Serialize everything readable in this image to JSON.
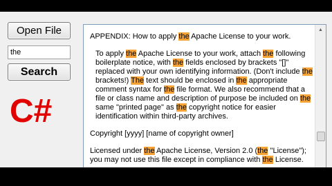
{
  "buttons": {
    "open_file": "Open File",
    "search": "Search"
  },
  "search_input": {
    "value": "the"
  },
  "logo_text": "C#",
  "document": {
    "paragraphs": [
      {
        "indent": false,
        "segments": [
          {
            "t": "APPENDIX: How to apply ",
            "h": false
          },
          {
            "t": "the",
            "h": true
          },
          {
            "t": " Apache License to your work.",
            "h": false
          }
        ]
      },
      {
        "indent": true,
        "segments": [
          {
            "t": "To apply ",
            "h": false
          },
          {
            "t": "the",
            "h": true
          },
          {
            "t": " Apache License to your work, attach ",
            "h": false
          },
          {
            "t": "the",
            "h": true
          },
          {
            "t": " following boilerplate notice, with ",
            "h": false
          },
          {
            "t": "the",
            "h": true
          },
          {
            "t": " fields enclosed by brackets \"[]\" replaced with your own identifying information. (Don't include ",
            "h": false
          },
          {
            "t": "the",
            "h": true
          },
          {
            "t": " brackets!)  ",
            "h": false
          },
          {
            "t": "The",
            "h": true
          },
          {
            "t": " text should be enclosed in ",
            "h": false
          },
          {
            "t": "the",
            "h": true
          },
          {
            "t": " appropriate comment syntax for ",
            "h": false
          },
          {
            "t": "the",
            "h": true
          },
          {
            "t": " file format. We also recommend that a file or class name and description of purpose be included on ",
            "h": false
          },
          {
            "t": "the",
            "h": true
          },
          {
            "t": " same \"printed page\" as ",
            "h": false
          },
          {
            "t": "the",
            "h": true
          },
          {
            "t": " copyright notice for easier identification within third-party archives.",
            "h": false
          }
        ]
      },
      {
        "indent": false,
        "segments": [
          {
            "t": "Copyright [yyyy] [name of copyright owner]",
            "h": false
          }
        ]
      },
      {
        "indent": false,
        "segments": [
          {
            "t": "Licensed under ",
            "h": false
          },
          {
            "t": "the",
            "h": true
          },
          {
            "t": " Apache License, Version 2.0 (",
            "h": false
          },
          {
            "t": "the",
            "h": true
          },
          {
            "t": " \"License\"); you may not use this file except in compliance with ",
            "h": false
          },
          {
            "t": "the",
            "h": true
          },
          {
            "t": " License.",
            "h": false
          }
        ]
      }
    ]
  },
  "icons": {
    "scroll_up": "scroll-up-arrow-icon"
  },
  "colors": {
    "highlight": "#f7a234",
    "logo": "#e20000"
  }
}
